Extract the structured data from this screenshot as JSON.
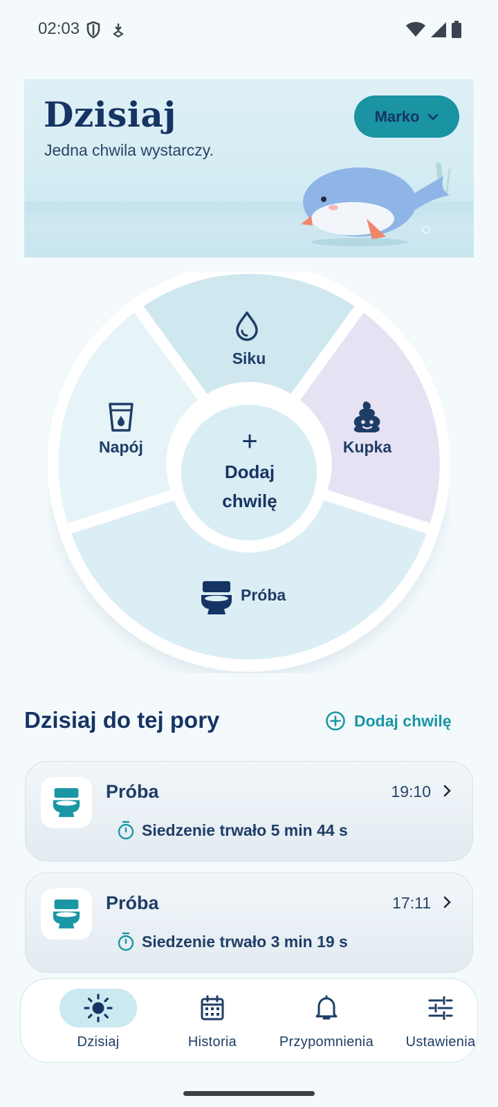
{
  "status_bar": {
    "time": "02:03",
    "left_icons": [
      "shield-icon",
      "download-icon"
    ],
    "right_icons": [
      "wifi-icon",
      "signal-icon",
      "battery-icon"
    ]
  },
  "header": {
    "title": "Dzisiaj",
    "subtitle": "Jedna chwila wystarczy.",
    "profile_name": "Marko"
  },
  "wheel": {
    "segments": [
      {
        "label": "Siku",
        "icon": "drop-icon",
        "color": "#cfe8f0"
      },
      {
        "label": "Kupka",
        "icon": "poop-icon",
        "color": "#e6e2f4"
      },
      {
        "label": "Próba",
        "icon": "toilet-icon",
        "color": "#dbedf5"
      },
      {
        "label": "Napój",
        "icon": "cup-icon",
        "color": "#e6f3f7"
      }
    ],
    "center_plus": "+",
    "center_line1": "Dodaj",
    "center_line2": "chwilę"
  },
  "today": {
    "title": "Dzisiaj do tej pory",
    "add_label": "Dodaj chwilę",
    "entries": [
      {
        "title": "Próba",
        "time": "19:10",
        "detail": "Siedzenie trwało 5 min 44 s"
      },
      {
        "title": "Próba",
        "time": "17:11",
        "detail": "Siedzenie trwało 3 min 19 s"
      }
    ]
  },
  "nav": {
    "items": [
      {
        "label": "Dzisiaj",
        "icon": "sun-icon",
        "active": true
      },
      {
        "label": "Historia",
        "icon": "calendar-icon",
        "active": false
      },
      {
        "label": "Przypomnienia",
        "icon": "bell-icon",
        "active": false
      },
      {
        "label": "Ustawienia",
        "icon": "sliders-icon",
        "active": false
      }
    ]
  },
  "colors": {
    "accent": "#1a93a3",
    "navy": "#163463",
    "background": "#f4fafc"
  }
}
